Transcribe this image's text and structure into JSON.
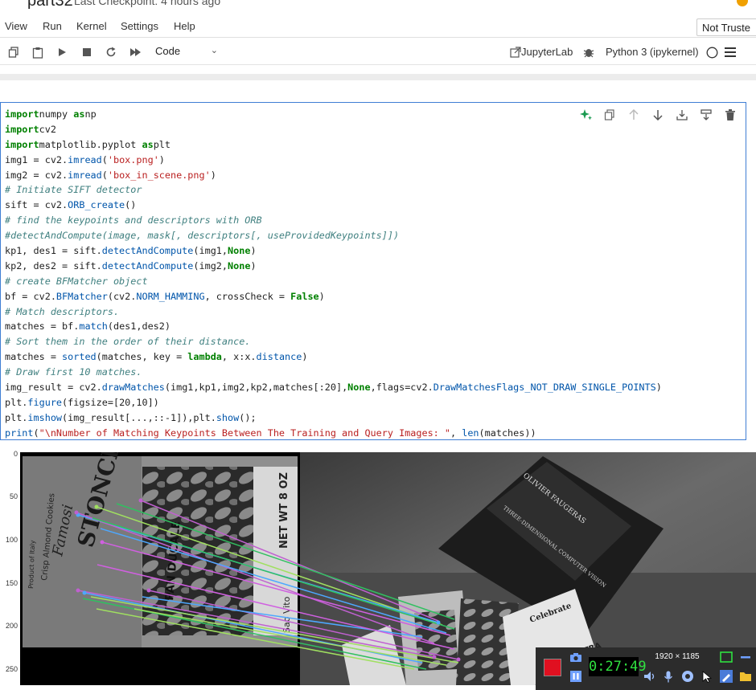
{
  "window": {
    "title": "part32",
    "subtitle": "Last Checkpoint: 4 hours ago"
  },
  "menu": {
    "items": [
      "View",
      "Run",
      "Kernel",
      "Settings",
      "Help"
    ],
    "trust_label": "Not Truste"
  },
  "toolbar": {
    "cell_type": "Code",
    "jupyterlab_label": "JupyterLab",
    "kernel_label": "Python 3 (ipykernel)"
  },
  "code_lines": [
    [
      [
        "kw",
        "import"
      ],
      [
        "",
        "numpy "
      ],
      [
        "kw",
        "as"
      ],
      [
        "",
        "np"
      ]
    ],
    [
      [
        "kw",
        "import"
      ],
      [
        "",
        "cv2"
      ]
    ],
    [
      [
        "kw",
        "import"
      ],
      [
        "",
        "matplotlib.pyplot "
      ],
      [
        "kw",
        "as"
      ],
      [
        "",
        "plt"
      ]
    ],
    [
      [
        "",
        "img1 = cv2."
      ],
      [
        "fn",
        "imread"
      ],
      [
        "",
        "("
      ],
      [
        "st",
        "'box.png'"
      ],
      [
        "",
        ")"
      ]
    ],
    [
      [
        "",
        "img2 = cv2."
      ],
      [
        "fn",
        "imread"
      ],
      [
        "",
        "("
      ],
      [
        "st",
        "'box_in_scene.png'"
      ],
      [
        "",
        ")"
      ]
    ],
    [
      [
        "cm",
        "# Initiate SIFT detector"
      ]
    ],
    [
      [
        "",
        "sift = cv2."
      ],
      [
        "fn",
        "ORB_create"
      ],
      [
        "",
        "()"
      ]
    ],
    [
      [
        "cm",
        "# find the keypoints and descriptors with ORB"
      ]
    ],
    [
      [
        "cm",
        "#detectAndCompute(image, mask[, descriptors[, useProvidedKeypoints]])"
      ]
    ],
    [
      [
        "",
        "kp1, des1 = sift."
      ],
      [
        "fn",
        "detectAndCompute"
      ],
      [
        "",
        "(img1,"
      ],
      [
        "kw",
        "None"
      ],
      [
        "",
        ")"
      ]
    ],
    [
      [
        "",
        "kp2, des2 = sift."
      ],
      [
        "fn",
        "detectAndCompute"
      ],
      [
        "",
        "(img2,"
      ],
      [
        "kw",
        "None"
      ],
      [
        "",
        ")"
      ]
    ],
    [
      [
        "cm",
        "# create BFMatcher object"
      ]
    ],
    [
      [
        "",
        "bf = cv2."
      ],
      [
        "fn",
        "BFMatcher"
      ],
      [
        "",
        "(cv2."
      ],
      [
        "fn",
        "NORM_HAMMING"
      ],
      [
        "",
        ", crossCheck = "
      ],
      [
        "kw",
        "False"
      ],
      [
        "",
        ")"
      ]
    ],
    [
      [
        "cm",
        "# Match descriptors."
      ]
    ],
    [
      [
        "",
        "matches = bf."
      ],
      [
        "fn",
        "match"
      ],
      [
        "",
        "(des1,des2)"
      ]
    ],
    [
      [
        "cm",
        "# Sort them in the order of their distance."
      ]
    ],
    [
      [
        "",
        "matches = "
      ],
      [
        "fn",
        "sorted"
      ],
      [
        "",
        "(matches, key = "
      ],
      [
        "kw",
        "lambda"
      ],
      [
        "",
        ", x:x."
      ],
      [
        "fn",
        "distance"
      ],
      [
        "",
        ")"
      ]
    ],
    [
      [
        "cm",
        "# Draw first 10 matches."
      ]
    ],
    [
      [
        "",
        "img_result = cv2."
      ],
      [
        "fn",
        "drawMatches"
      ],
      [
        "",
        "(img1,kp1,img2,kp2,matches[:20],"
      ],
      [
        "kw",
        "None"
      ],
      [
        "",
        ",flags=cv2."
      ],
      [
        "fn",
        "DrawMatchesFlags_NOT_DRAW_SINGLE_POINTS"
      ],
      [
        "",
        ")"
      ]
    ],
    [
      [
        "",
        "plt."
      ],
      [
        "fn",
        "figure"
      ],
      [
        "",
        "(figsize=[20,10])"
      ]
    ],
    [
      [
        "",
        "plt."
      ],
      [
        "fn",
        "imshow"
      ],
      [
        "",
        "(img_result[...,::-1]),plt."
      ],
      [
        "fn",
        "show"
      ],
      [
        "",
        "();"
      ]
    ],
    [
      [
        "fn",
        "print"
      ],
      [
        "",
        "("
      ],
      [
        "st",
        "\"\\nNumber of Matching Keypoints Between The Training and Query Images: \""
      ],
      [
        "",
        ", "
      ],
      [
        "fn",
        "len"
      ],
      [
        "",
        "(matches))"
      ]
    ]
  ],
  "plot": {
    "y_ticks": [
      "0",
      "50",
      "100",
      "150",
      "200",
      "250"
    ],
    "box_text": [
      "STONCINI",
      "Famosi",
      "Crisp Almond Cookies",
      "Product of Italy",
      "PAN DUCALE",
      "NET WT 8 OZ",
      "Sao Vito"
    ],
    "scene_text": [
      "OLIVIER FAUGERAS",
      "THREE-DIMENSIONAL COMPUTER VISION",
      "Celebrate",
      "ULTRA"
    ]
  },
  "recorder": {
    "timer": "0:27:49",
    "resolution": "1920 × 1185"
  },
  "colors": {
    "accent": "#3f7ed4",
    "record": "#e01020",
    "timer": "#30e040"
  }
}
